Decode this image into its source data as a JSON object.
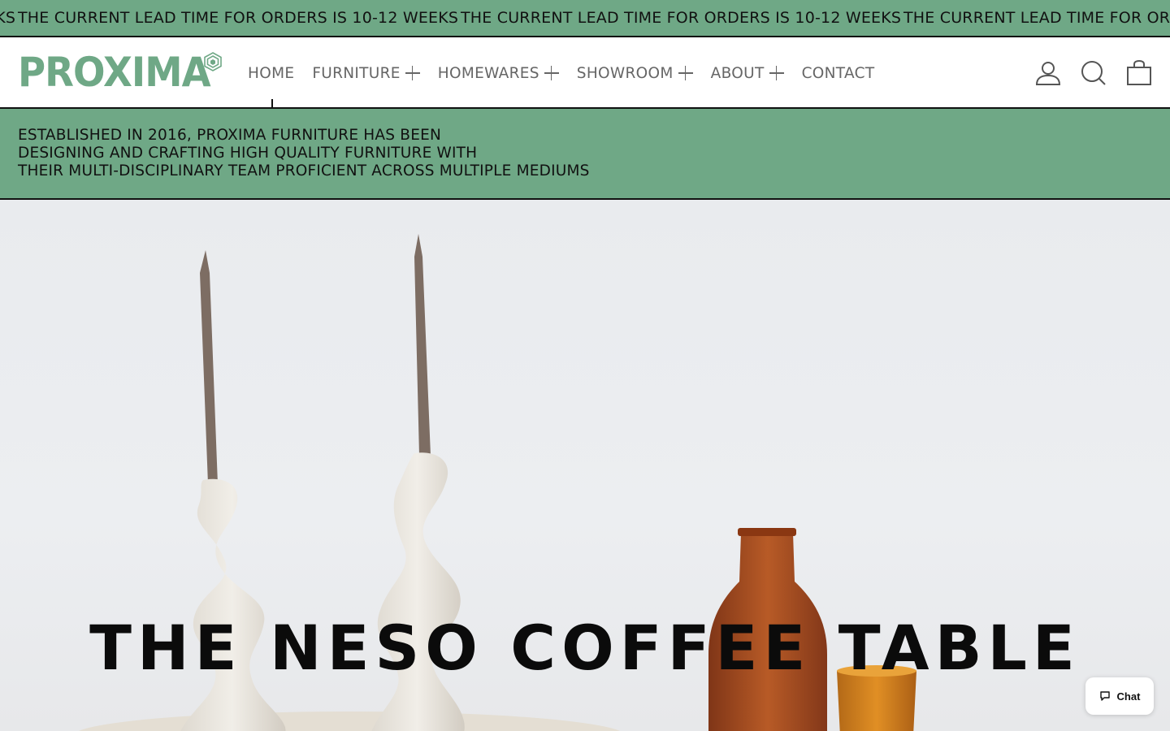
{
  "announcement": {
    "text": "THE CURRENT LEAD TIME FOR ORDERS IS 10-12 WEEKS"
  },
  "brand": {
    "name": "PROXIMA",
    "color": "#6fa886"
  },
  "nav": {
    "items": [
      {
        "label": "HOME",
        "has_submenu": false,
        "active": true
      },
      {
        "label": "FURNITURE",
        "has_submenu": true
      },
      {
        "label": "HOMEWARES",
        "has_submenu": true
      },
      {
        "label": "SHOWROOM",
        "has_submenu": true
      },
      {
        "label": "ABOUT",
        "has_submenu": true
      },
      {
        "label": "CONTACT",
        "has_submenu": false
      }
    ]
  },
  "header_icons": [
    "account-icon",
    "search-icon",
    "cart-icon"
  ],
  "intro": {
    "lines": [
      "ESTABLISHED IN 2016, PROXIMA FURNITURE HAS BEEN",
      "DESIGNING AND CRAFTING HIGH QUALITY FURNITURE WITH",
      "THEIR MULTI-DISCIPLINARY TEAM PROFICIENT ACROSS MULTIPLE MEDIUMS"
    ]
  },
  "hero": {
    "title": "THE NESO COFFEE TABLE"
  },
  "chat": {
    "label": "Chat"
  }
}
